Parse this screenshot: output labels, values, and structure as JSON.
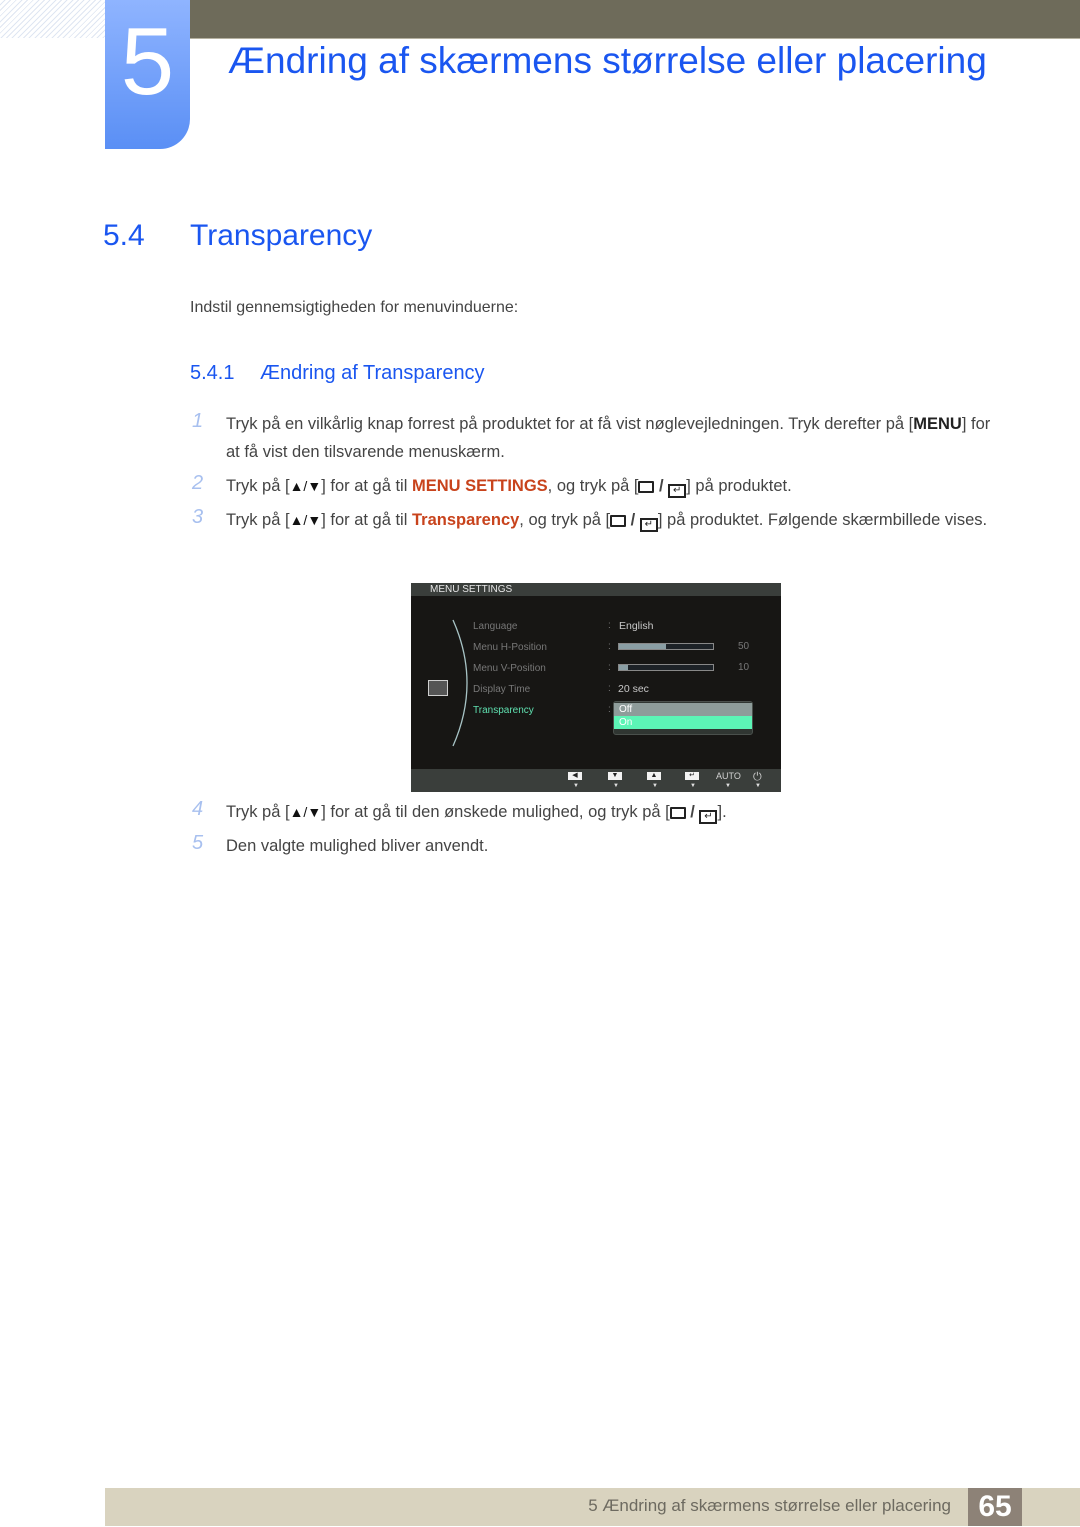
{
  "chapter": {
    "number": "5",
    "title": "Ændring af skærmens størrelse eller placering"
  },
  "section": {
    "number": "5.4",
    "title": "Transparency",
    "intro": "Indstil gennemsigtigheden for menuvinduerne:"
  },
  "subsection": {
    "number": "5.4.1",
    "title": "Ændring af Transparency"
  },
  "steps": [
    {
      "n": "1",
      "a": "Tryk på en vilkårlig knap forrest på produktet for at få vist nøglevejledningen. Tryk derefter på [",
      "key": "MENU",
      "b": "] for at få vist den tilsvarende menuskærm."
    },
    {
      "n": "2",
      "a": "Tryk på [",
      "arrows": "▲/▼",
      "b": "] for at gå til ",
      "hl": "MENU SETTINGS",
      "c": ", og tryk på [",
      "d": "] på produktet."
    },
    {
      "n": "3",
      "a": "Tryk på [",
      "arrows": "▲/▼",
      "b": "] for at gå til ",
      "hl": "Transparency",
      "c": ", og tryk på [",
      "d": "] på produktet. Følgende skærmbillede vises."
    },
    {
      "n": "4",
      "a": "Tryk på [",
      "arrows": "▲/▼",
      "b": "] for at gå til den ønskede mulighed, og tryk på [",
      "d": "]."
    },
    {
      "n": "5",
      "a": "Den valgte mulighed bliver anvendt."
    }
  ],
  "osd": {
    "header": "MENU SETTINGS",
    "rows": [
      {
        "label": "Language",
        "value": "English"
      },
      {
        "label": "Menu H-Position",
        "bar": 50,
        "value": "50"
      },
      {
        "label": "Menu V-Position",
        "bar": 10,
        "value": "10"
      },
      {
        "label": "Display Time",
        "value": "20 sec"
      },
      {
        "label": "Transparency",
        "selected": true
      }
    ],
    "dropdown": {
      "options": [
        "Off",
        "On"
      ],
      "highlighted": "On"
    },
    "footer_buttons": [
      "left-arrow",
      "down-arrow",
      "up-arrow",
      "enter",
      "AUTO",
      "power"
    ],
    "auto_label": "AUTO",
    "colors": {
      "selected_text": "#5fe0b0",
      "highlight": "#5cf5b6"
    }
  },
  "footer": {
    "text": "5 Ændring af skærmens størrelse eller placering",
    "page": "65"
  },
  "colors": {
    "heading": "#1a56f0",
    "highlight": "#c8431c",
    "topbar": "#6e6b5a",
    "footer": "#d9d3bf"
  }
}
